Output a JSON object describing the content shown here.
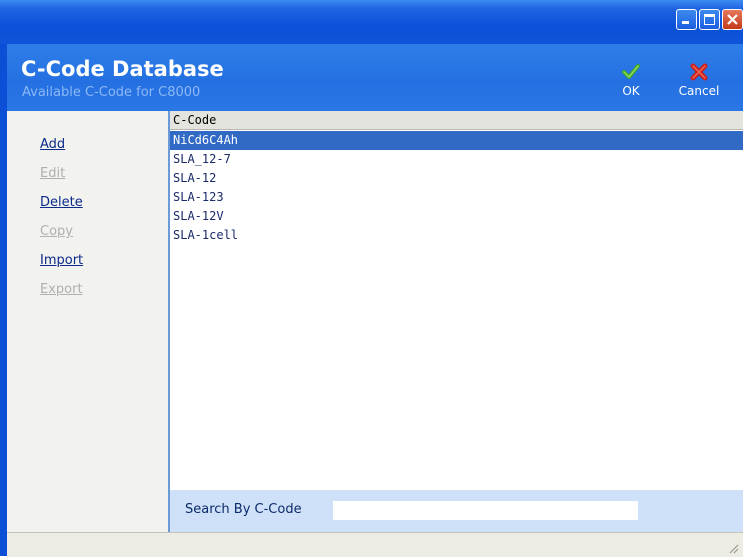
{
  "window": {
    "controls": [
      "minimize-icon",
      "maximize-icon",
      "close-icon"
    ]
  },
  "header": {
    "title": "C-Code Database",
    "subtitle": "Available C-Code for C8000",
    "ok_label": "OK",
    "cancel_label": "Cancel"
  },
  "sidebar": {
    "items": [
      {
        "label": "Add",
        "enabled": true
      },
      {
        "label": "Edit",
        "enabled": false
      },
      {
        "label": "Delete",
        "enabled": true
      },
      {
        "label": "Copy",
        "enabled": false
      },
      {
        "label": "Import",
        "enabled": true
      },
      {
        "label": "Export",
        "enabled": false
      }
    ]
  },
  "table": {
    "column_header": "C-Code",
    "rows": [
      "NiCd6C4Ah",
      "SLA_12-7",
      "SLA-12",
      "SLA-123",
      "SLA-12V",
      "SLA-1cell"
    ],
    "selected_index": 0
  },
  "search": {
    "label": "Search By C-Code",
    "value": ""
  },
  "colors": {
    "titlebar": "#0a50d8",
    "header": "#2a76e4",
    "selection": "#316ac5",
    "search_bar": "#cfe1f8"
  }
}
